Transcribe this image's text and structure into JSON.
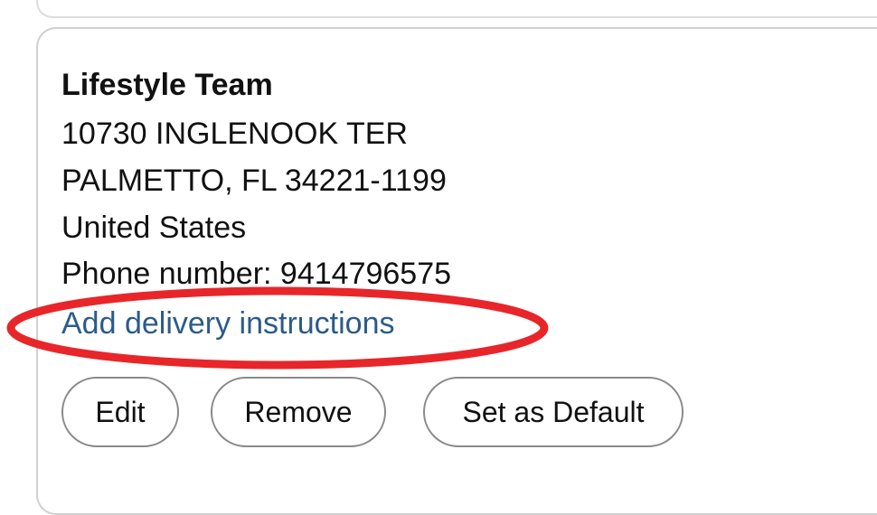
{
  "address": {
    "name": "Lifestyle Team",
    "street": "10730 INGLENOOK TER",
    "city_state_zip": "PALMETTO, FL 34221-1199",
    "country": "United States",
    "phone_label": "Phone number:",
    "phone_number": "9414796575",
    "phone_line": "Phone number: 9414796575"
  },
  "delivery_instructions_link": "Add delivery instructions",
  "actions": {
    "edit": "Edit",
    "remove": "Remove",
    "set_default": "Set as Default"
  },
  "colors": {
    "link": "#2b5b8a",
    "annotation": "#e8262a",
    "card_border": "#d0d0d0"
  }
}
